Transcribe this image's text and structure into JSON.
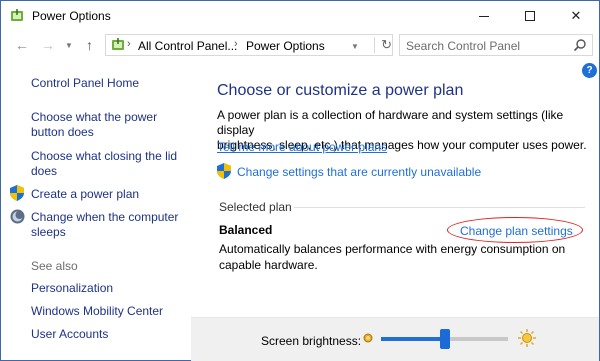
{
  "window": {
    "title": "Power Options"
  },
  "address": {
    "crumbs": [
      "All Control Panel...",
      "Power Options"
    ],
    "search_placeholder": "Search Control Panel"
  },
  "sidebar": {
    "home": "Control Panel Home",
    "tasks": [
      {
        "label": "Choose what the power button does",
        "line1": "Choose what the power",
        "line2": "button does"
      },
      {
        "label": "Choose what closing the lid does",
        "line1": "Choose what closing the lid",
        "line2": "does"
      },
      {
        "label": "Create a power plan",
        "line1": "Create a power plan"
      },
      {
        "label": "Change when the computer sleeps",
        "line1": "Change when the computer",
        "line2": "sleeps"
      }
    ],
    "see_also": {
      "heading": "See also",
      "items": [
        "Personalization",
        "Windows Mobility Center",
        "User Accounts"
      ]
    }
  },
  "main": {
    "title": "Choose or customize a power plan",
    "description_line1": "A power plan is a collection of hardware and system settings (like display",
    "description_line2": "brightness, sleep, etc.) that manages how your computer uses power.",
    "tell_more": "Tell me more about power plans",
    "change_unavailable": "Change settings that are currently unavailable",
    "selected_plan_heading": "Selected plan",
    "plan": {
      "name": "Balanced",
      "change_link": "Change plan settings",
      "desc_line1": "Automatically balances performance with energy consumption on",
      "desc_line2": "capable hardware."
    }
  },
  "brightness": {
    "label": "Screen brightness:",
    "level_percent": 50
  },
  "colors": {
    "link": "#1f6fd6",
    "nav_link": "#1e3287",
    "highlight_oval": "#e02020"
  }
}
